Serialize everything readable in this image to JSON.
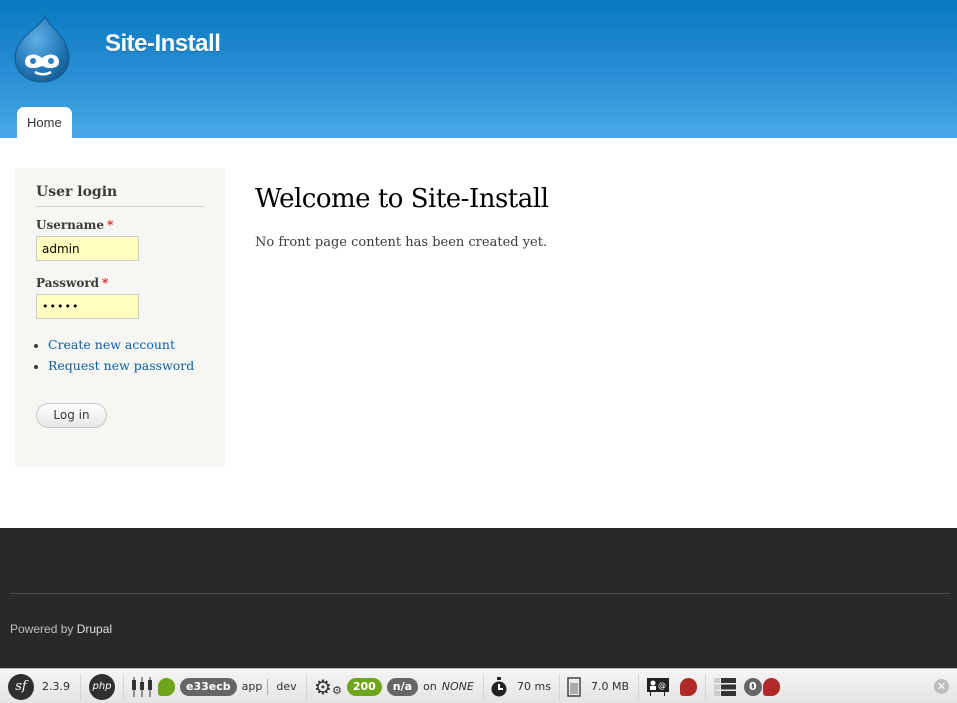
{
  "header": {
    "site_name": "Site-Install",
    "logo_alt": "drupal-drop-logo",
    "menu": [
      {
        "label": "Home",
        "active": true
      }
    ]
  },
  "sidebar": {
    "block_title": "User login",
    "username": {
      "label": "Username",
      "required_mark": "*",
      "value": "admin"
    },
    "password": {
      "label": "Password",
      "required_mark": "*",
      "value": "•••••"
    },
    "links": [
      {
        "label": "Create new account"
      },
      {
        "label": "Request new password"
      }
    ],
    "submit_label": "Log in"
  },
  "main": {
    "title": "Welcome to Site-Install",
    "body": "No front page content has been created yet."
  },
  "footer": {
    "powered_prefix": "Powered by ",
    "powered_link": "Drupal"
  },
  "toolbar": {
    "symfony_logo": "sf",
    "symfony_version": "2.3.9",
    "php_logo": "php",
    "token": "e33ecb",
    "app": "app",
    "env": "dev",
    "status_code": "200",
    "route": "n/a",
    "on_label": "on",
    "route_name": "NONE",
    "time": "70 ms",
    "memory": "7.0 MB",
    "db_queries": "0",
    "close": "✕",
    "colors": {
      "green": "#6ea51a",
      "red": "#b02a2a",
      "grey": "#666666"
    }
  }
}
